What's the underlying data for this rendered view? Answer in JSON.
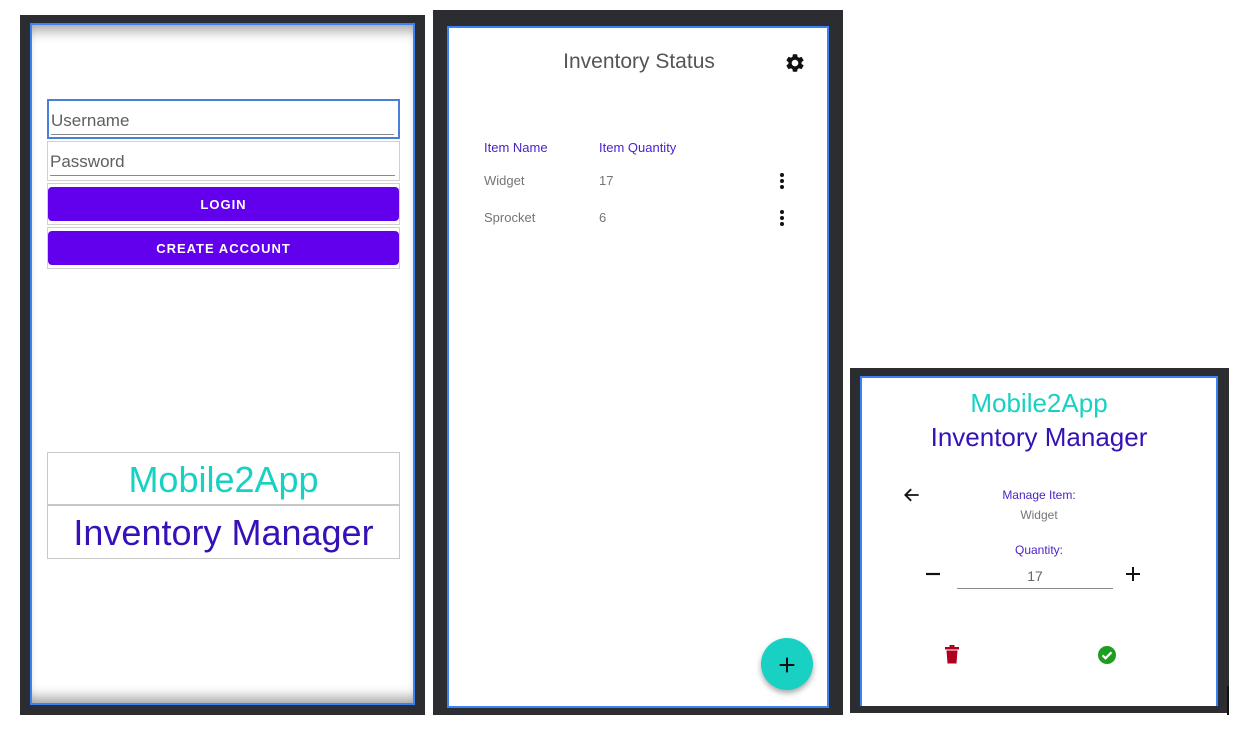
{
  "login": {
    "username_placeholder": "Username",
    "password_placeholder": "Password",
    "login_label": "LOGIN",
    "create_account_label": "CREATE ACCOUNT",
    "brand_top": "Mobile2App",
    "brand_bottom": "Inventory Manager"
  },
  "inventory": {
    "title": "Inventory Status",
    "settings_icon": "gear-icon",
    "col_name": "Item Name",
    "col_quantity": "Item Quantity",
    "items": [
      {
        "name": "Widget",
        "quantity": "17"
      },
      {
        "name": "Sprocket",
        "quantity": "6"
      }
    ],
    "add_icon": "plus-icon"
  },
  "manage": {
    "brand_top": "Mobile2App",
    "brand_bottom": "Inventory Manager",
    "manage_label": "Manage Item:",
    "item_name": "Widget",
    "quantity_label": "Quantity:",
    "quantity_value": "17"
  },
  "colors": {
    "primary": "#6200ee",
    "accent": "#18d1c3",
    "brand_dark": "#3711b8",
    "delete": "#b00020",
    "confirm": "#1e9e1e"
  }
}
